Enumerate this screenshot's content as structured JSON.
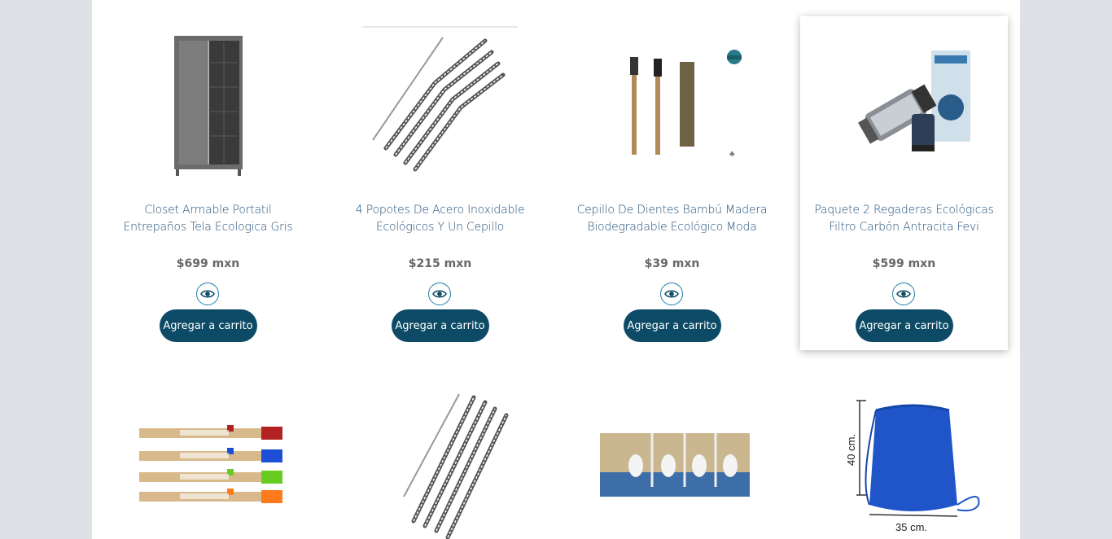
{
  "colors": {
    "accent": "#0d4a66",
    "title": "#1f4e79",
    "price": "#666666",
    "background": "#dde0e5"
  },
  "products": [
    {
      "title": "Closet Armable Portatil Entrepaños Tela Ecologica Gris",
      "price": "$699 mxn",
      "button": "Agregar a carrito",
      "icon": "eye-icon"
    },
    {
      "title": "4 Popotes De Acero Inoxidable Ecológicos Y Un Cepillo",
      "price": "$215 mxn",
      "button": "Agregar a carrito",
      "icon": "eye-icon"
    },
    {
      "title": "Cepillo De Dientes Bambú Madera Biodegradable Ecológico Moda",
      "price": "$39 mxn",
      "button": "Agregar a carrito",
      "icon": "eye-icon"
    },
    {
      "title": "Paquete 2 Regaderas Ecológicas Filtro Carbón Antracita Fevi",
      "price": "$599 mxn",
      "button": "Agregar a carrito",
      "icon": "eye-icon"
    }
  ],
  "row2": [
    {
      "image": "pens"
    },
    {
      "image": "straws"
    },
    {
      "image": "urinals"
    },
    {
      "image": "drawstring-bag",
      "labels": [
        "40 cm.",
        "35 cm."
      ]
    }
  ]
}
